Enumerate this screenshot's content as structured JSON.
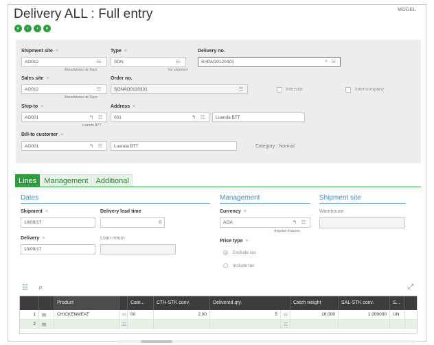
{
  "page": {
    "title": "Delivery ALL : Full entry",
    "model_tag": "MODEL"
  },
  "nav_buttons": [
    "first",
    "previous",
    "next",
    "last"
  ],
  "header": {
    "shipment_site": {
      "label": "Shipment site",
      "value": "AO012",
      "sub": "Manufatures de Soyo"
    },
    "type": {
      "label": "Type",
      "value": "SDN",
      "sub": "Ver shipment"
    },
    "delivery_no": {
      "label": "Delivery no.",
      "value": "SHPAO0120403"
    },
    "sales_site": {
      "label": "Sales site",
      "value": "AO012",
      "sub": "Manufatures de Soyo"
    },
    "order_no": {
      "label": "Order no.",
      "value": "SONAO0120331"
    },
    "intersite": {
      "label": "Intersite",
      "checked": false
    },
    "intercompany": {
      "label": "Intercompany",
      "checked": false
    },
    "ship_to": {
      "label": "Ship-to",
      "value": "AO001",
      "sub": "Luanda BTT"
    },
    "address": {
      "label": "Address",
      "code": "001",
      "value": "Luanda BTT"
    },
    "bill_to_customer": {
      "label": "Bill-to customer",
      "value": "AO001",
      "name": "Luanda BTT"
    },
    "category": "Category : Normal"
  },
  "tabs": [
    {
      "label": "Lines",
      "active": true
    },
    {
      "label": "Management",
      "active": false
    },
    {
      "label": "Additional",
      "active": false
    }
  ],
  "sections": {
    "dates": {
      "title": "Dates",
      "shipment": {
        "label": "Shipment",
        "value": "10/09/17"
      },
      "delivery_lead_time": {
        "label": "Delivery lead time",
        "value": "0"
      },
      "delivery": {
        "label": "Delivery",
        "value": "10/09/17"
      },
      "loan_return": {
        "label": "Loan return",
        "value": ""
      }
    },
    "management": {
      "title": "Management",
      "currency": {
        "label": "Currency",
        "value": "AOA",
        "sub": "Angolan Kwanza"
      },
      "price_type": {
        "label": "Price type",
        "options": [
          {
            "label": "Exclude tax",
            "selected": true
          },
          {
            "label": "Include tax",
            "selected": false
          }
        ]
      }
    },
    "shipment_site": {
      "title": "Shipment site",
      "warehouse": {
        "label": "Warehouse",
        "value": ""
      }
    }
  },
  "grid": {
    "columns": [
      "",
      "",
      "Product",
      "",
      "Cate...",
      "CTH-STK conv.",
      "Delivered qty.",
      "Catch weight",
      "SAL-STK conv.",
      "S..."
    ],
    "rows": [
      {
        "num": "1",
        "product": "CHICKENMEAT",
        "category": "00",
        "cth_stk_conv": "2.00",
        "delivered_qty": "5",
        "catch_weight": "16.000",
        "sal_stk_conv": "1.000000",
        "unit": "UN"
      },
      {
        "num": "2",
        "product": "",
        "category": "",
        "cth_stk_conv": "",
        "delivered_qty": "",
        "catch_weight": "",
        "sal_stk_conv": "",
        "unit": ""
      }
    ]
  },
  "icons": {
    "lookup": "list-icon",
    "detail": "zoom-icon",
    "search": "magnifier-icon",
    "expand": "expand-icon"
  },
  "colors": {
    "accent_green": "#2e9e3f",
    "section_blue": "#4a8ab8",
    "grid_header": "#3d3d3d",
    "panel_gray": "#ededed"
  }
}
